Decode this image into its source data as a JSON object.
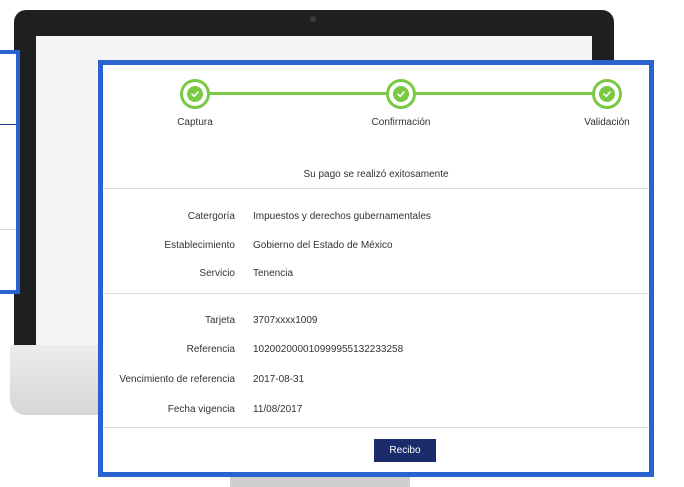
{
  "colors": {
    "accent_green": "#7ac943",
    "frame_blue": "#2a63cf",
    "button_navy": "#1b2b6b"
  },
  "stepper": {
    "steps": [
      {
        "label": "Captura",
        "icon": "check-icon",
        "status": "complete"
      },
      {
        "label": "Confirmación",
        "icon": "check-icon",
        "status": "complete"
      },
      {
        "label": "Validación",
        "icon": "check-icon",
        "status": "complete"
      }
    ]
  },
  "message": "Su pago se realizó exitosamente",
  "service_details": [
    {
      "label": "Catergoría",
      "value": "Impuestos y derechos gubernamentales"
    },
    {
      "label": "Establecimiento",
      "value": "Gobierno del Estado de México"
    },
    {
      "label": "Servicio",
      "value": "Tenencia"
    }
  ],
  "payment_details": [
    {
      "label": "Tarjeta",
      "value": "3707xxxx1009"
    },
    {
      "label": "Referencia",
      "value": "10200200001099995513223325‌8"
    },
    {
      "label": "Vencimiento de referencia",
      "value": "2017-08-31"
    },
    {
      "label": "Fecha vigencia",
      "value": "11/08/2017"
    }
  ],
  "receipt_button": "Recibo"
}
